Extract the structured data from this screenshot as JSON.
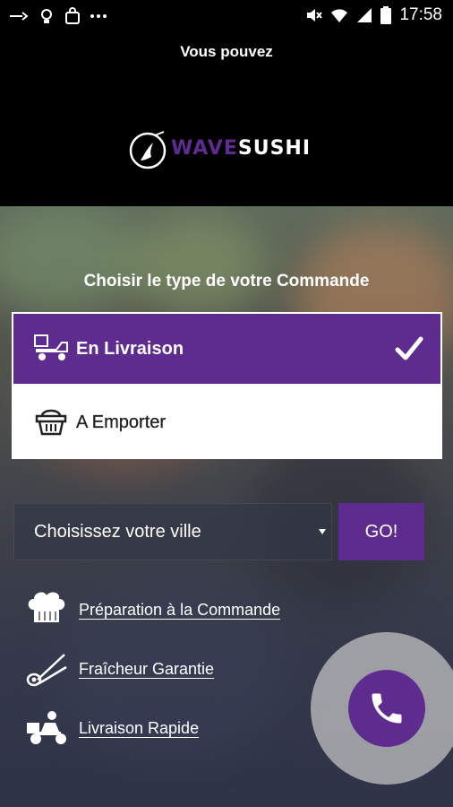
{
  "status_bar": {
    "time": "17:58",
    "icons": [
      "cast-icon",
      "lightbulb-icon",
      "shopping-bag-icon",
      "more-dots-icon",
      "mute-icon",
      "wifi-icon",
      "signal-icon",
      "battery-icon"
    ]
  },
  "header": {
    "marquee_text": "Vous pouvez",
    "logo": {
      "part1": "WAVE",
      "part2": "SUSHI"
    }
  },
  "order": {
    "title": "Choisir le type de votre Commande",
    "options": [
      {
        "label": "En Livraison",
        "icon": "delivery-scooter-icon",
        "selected": true
      },
      {
        "label": "A Emporter",
        "icon": "basket-icon",
        "selected": false
      }
    ]
  },
  "city": {
    "selected": "Choisissez votre ville",
    "go_label": "GO!"
  },
  "features": [
    {
      "label": "Préparation à la Commande",
      "icon": "chef-hat-icon"
    },
    {
      "label": "Fraîcheur Garantie",
      "icon": "chopsticks-icon"
    },
    {
      "label": "Livraison Rapide",
      "icon": "delivery-rider-icon"
    }
  ],
  "colors": {
    "brand": "#5e2c8f",
    "background": "#000000",
    "white": "#ffffff"
  }
}
